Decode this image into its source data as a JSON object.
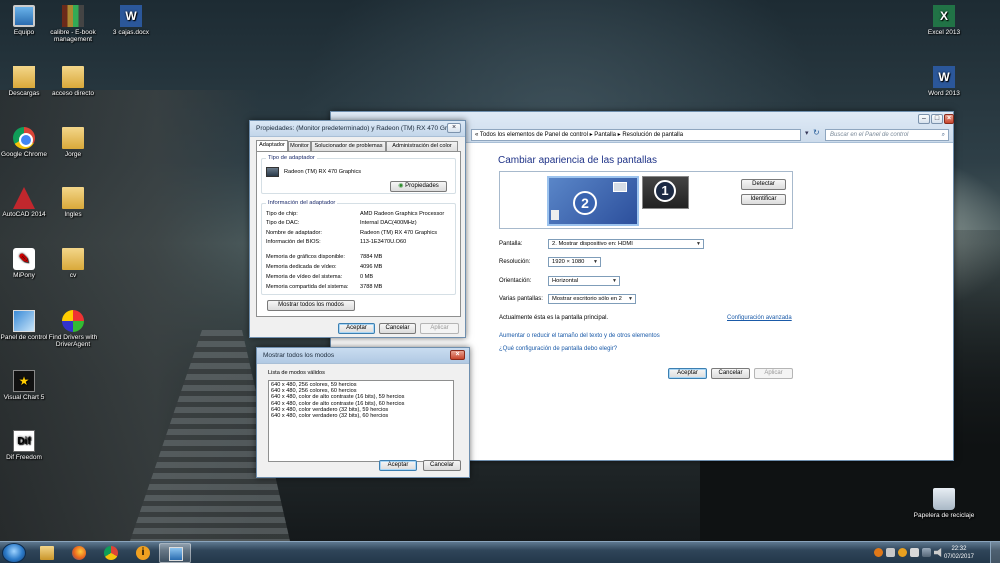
{
  "desktop": {
    "icons_left": [
      {
        "name": "Equipo",
        "icon": "computer-icon"
      },
      {
        "name": "Descargas",
        "icon": "downloads-folder-icon"
      },
      {
        "name": "Google Chrome",
        "icon": "chrome-icon"
      },
      {
        "name": "AutoCAD 2014",
        "icon": "autocad-icon"
      },
      {
        "name": "MiPony",
        "icon": "mipony-icon"
      },
      {
        "name": "Panel de control",
        "icon": "control-panel-icon"
      },
      {
        "name": "Visual Chart 5",
        "icon": "visual-chart-icon"
      },
      {
        "name": "Dif Freedom",
        "icon": "dif-icon"
      }
    ],
    "icons_col2": [
      {
        "name": "calibre - E-book management",
        "icon": "calibre-icon"
      },
      {
        "name": "acceso directo",
        "icon": "folder-icon"
      },
      {
        "name": "Jorge",
        "icon": "folder-icon"
      },
      {
        "name": "Ingles",
        "icon": "folder-icon"
      },
      {
        "name": "cv",
        "icon": "folder-icon"
      },
      {
        "name": "Find Drivers with DriverAgent",
        "icon": "driveragent-icon"
      }
    ],
    "icon_doc": {
      "name": "3 cajas.docx",
      "icon": "word-doc-icon"
    },
    "icons_right": [
      {
        "name": "Excel 2013",
        "icon": "excel-icon"
      },
      {
        "name": "Word 2013",
        "icon": "word-icon"
      },
      {
        "name": "Papelera de reciclaje",
        "icon": "recycle-bin-icon"
      }
    ]
  },
  "control_panel": {
    "breadcrumb": "« Todos los elementos de Panel de control  ▸  Pantalla  ▸  Resolución de pantalla",
    "search_placeholder": "Buscar en el Panel de control",
    "title": "Cambiar apariencia de las pantallas",
    "monitor_2": "2",
    "monitor_1": "1",
    "detect_button": "Detectar",
    "identify_button": "Identificar",
    "display_label": "Pantalla:",
    "display_value": "2. Mostrar dispositivo en: HDMI",
    "resolution_label": "Resolución:",
    "resolution_value": "1920 × 1080",
    "orientation_label": "Orientación:",
    "orientation_value": "Horizontal",
    "multiple_label": "Varias pantallas:",
    "multiple_value": "Mostrar escritorio sólo en 2",
    "main_display_text": "Actualmente ésta es la pantalla principal.",
    "advanced_link": "Configuración avanzada",
    "text_size_link": "Aumentar o reducir el tamaño del texto y de otros elementos",
    "which_settings_link": "¿Qué configuración de pantalla debo elegir?",
    "ok_button": "Aceptar",
    "cancel_button": "Cancelar",
    "apply_button": "Aplicar"
  },
  "properties": {
    "title": "Propiedades: (Monitor predeterminado) y Radeon (TM) RX 470 Gra...",
    "tabs": [
      "Adaptador",
      "Monitor",
      "Solucionador de problemas",
      "Administración del color"
    ],
    "adapter_type_group": "Tipo de adaptador",
    "adapter_name": "Radeon (TM) RX 470 Graphics",
    "properties_button": "Propiedades",
    "adapter_info_group": "Información del adaptador",
    "info": [
      {
        "k": "Tipo de chip:",
        "v": "AMD Radeon Graphics Processor"
      },
      {
        "k": "Tipo de DAC:",
        "v": "Internal DAC(400MHz)"
      },
      {
        "k": "Nombre de adaptador:",
        "v": "Radeon (TM) RX 470 Graphics"
      },
      {
        "k": "Información del BIOS:",
        "v": "113-1E3470U.O60"
      }
    ],
    "memory": [
      {
        "k": "Memoria de gráficos disponible:",
        "v": "7884 MB"
      },
      {
        "k": "Memoria dedicada de vídeo:",
        "v": "4096 MB"
      },
      {
        "k": "Memoria de vídeo del sistema:",
        "v": "0 MB"
      },
      {
        "k": "Memoria compartida del sistema:",
        "v": "3788 MB"
      }
    ],
    "show_modes_button": "Mostrar todos los modos",
    "ok_button": "Aceptar",
    "cancel_button": "Cancelar",
    "apply_button": "Aplicar"
  },
  "modes": {
    "title": "Mostrar todos los modos",
    "list_label": "Lista de modos válidos",
    "items": [
      "640 x 480, 256 colores, 59 hercios",
      "640 x 480, 256 colores, 60 hercios",
      "640 x 480, color de alto contraste (16 bits), 59 hercios",
      "640 x 480, color de alto contraste (16 bits), 60 hercios",
      "640 x 480, color verdadero (32 bits), 59 hercios",
      "640 x 480, color verdadero (32 bits), 60 hercios"
    ],
    "ok_button": "Aceptar",
    "cancel_button": "Cancelar"
  },
  "taskbar": {
    "time": "22:32",
    "date": "07/02/2017",
    "items": [
      "explorer-icon",
      "firefox-icon",
      "chrome-icon",
      "info-app-icon",
      "display-settings-icon"
    ]
  }
}
